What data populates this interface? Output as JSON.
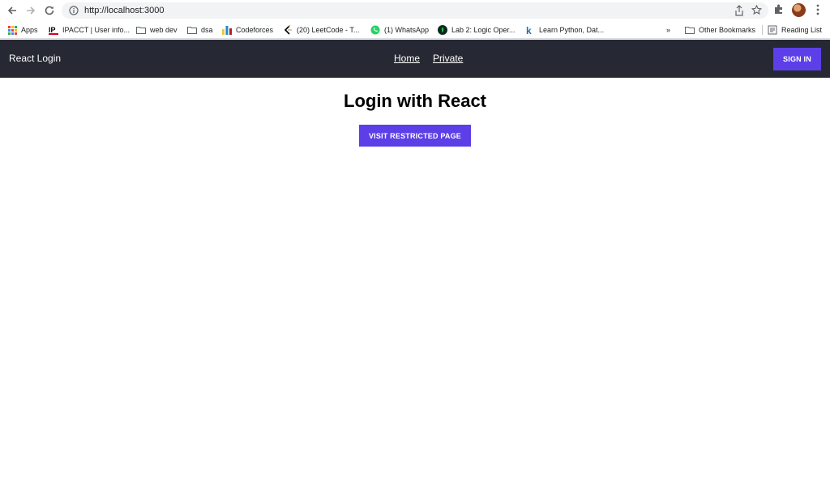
{
  "browser": {
    "url": "http://localhost:3000",
    "bookmarks": [
      {
        "label": "Apps",
        "icon": "apps-grid-icon"
      },
      {
        "label": "IPACCT | User info...",
        "icon": "ipacct-icon"
      },
      {
        "label": "web dev",
        "icon": "folder-icon"
      },
      {
        "label": "dsa",
        "icon": "folder-icon"
      },
      {
        "label": "Codeforces",
        "icon": "codeforces-icon"
      },
      {
        "label": "(20) LeetCode - T...",
        "icon": "leetcode-icon"
      },
      {
        "label": "(1) WhatsApp",
        "icon": "whatsapp-icon"
      },
      {
        "label": "Lab 2: Logic Oper...",
        "icon": "lab-icon"
      },
      {
        "label": "Learn Python, Dat...",
        "icon": "k-icon"
      }
    ],
    "overflow": "»",
    "other_bookmarks": "Other Bookmarks",
    "reading_list": "Reading List"
  },
  "navbar": {
    "brand": "React Login",
    "links": [
      "Home",
      "Private"
    ],
    "signin_label": "SIGN IN",
    "accent": "#5d3fe8",
    "background": "#262934"
  },
  "main": {
    "title": "Login with React",
    "button_label": "VISIT RESTRICTED PAGE"
  }
}
